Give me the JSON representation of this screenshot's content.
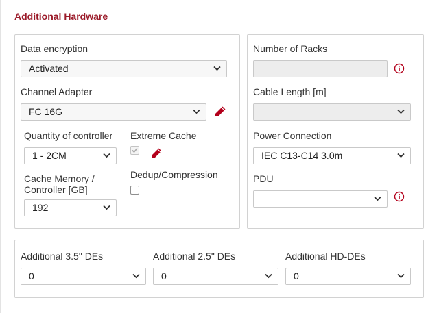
{
  "section": {
    "title": "Additional Hardware"
  },
  "left_panel": {
    "data_encryption": {
      "label": "Data encryption",
      "value": "Activated"
    },
    "channel_adapter": {
      "label": "Channel Adapter",
      "value": "FC 16G"
    },
    "quantity_controller": {
      "label": "Quantity of controller",
      "value": "1 - 2CM"
    },
    "extreme_cache": {
      "label": "Extreme Cache",
      "checked": true,
      "disabled": true
    },
    "cache_memory": {
      "label_line1": "Cache Memory /",
      "label_line2": "Controller [GB]",
      "value": "192"
    },
    "dedup": {
      "label": "Dedup/Compression",
      "checked": false
    }
  },
  "right_panel": {
    "number_of_racks": {
      "label": "Number of Racks",
      "value": ""
    },
    "cable_length": {
      "label": "Cable Length [m]",
      "value": ""
    },
    "power_connection": {
      "label": "Power Connection",
      "value": "IEC C13-C14 3.0m"
    },
    "pdu": {
      "label": "PDU",
      "value": ""
    }
  },
  "bottom_panel": {
    "de35": {
      "label": "Additional 3.5\" DEs",
      "value": "0"
    },
    "de25": {
      "label": "Additional 2.5\" DEs",
      "value": "0"
    },
    "hdde": {
      "label": "Additional HD-DEs",
      "value": "0"
    }
  },
  "colors": {
    "accent": "#9b1b2a",
    "icon_red": "#b3001b"
  },
  "icons": {
    "edit": "pencil-icon",
    "info": "info-icon",
    "chevron": "chevron-down-icon"
  }
}
